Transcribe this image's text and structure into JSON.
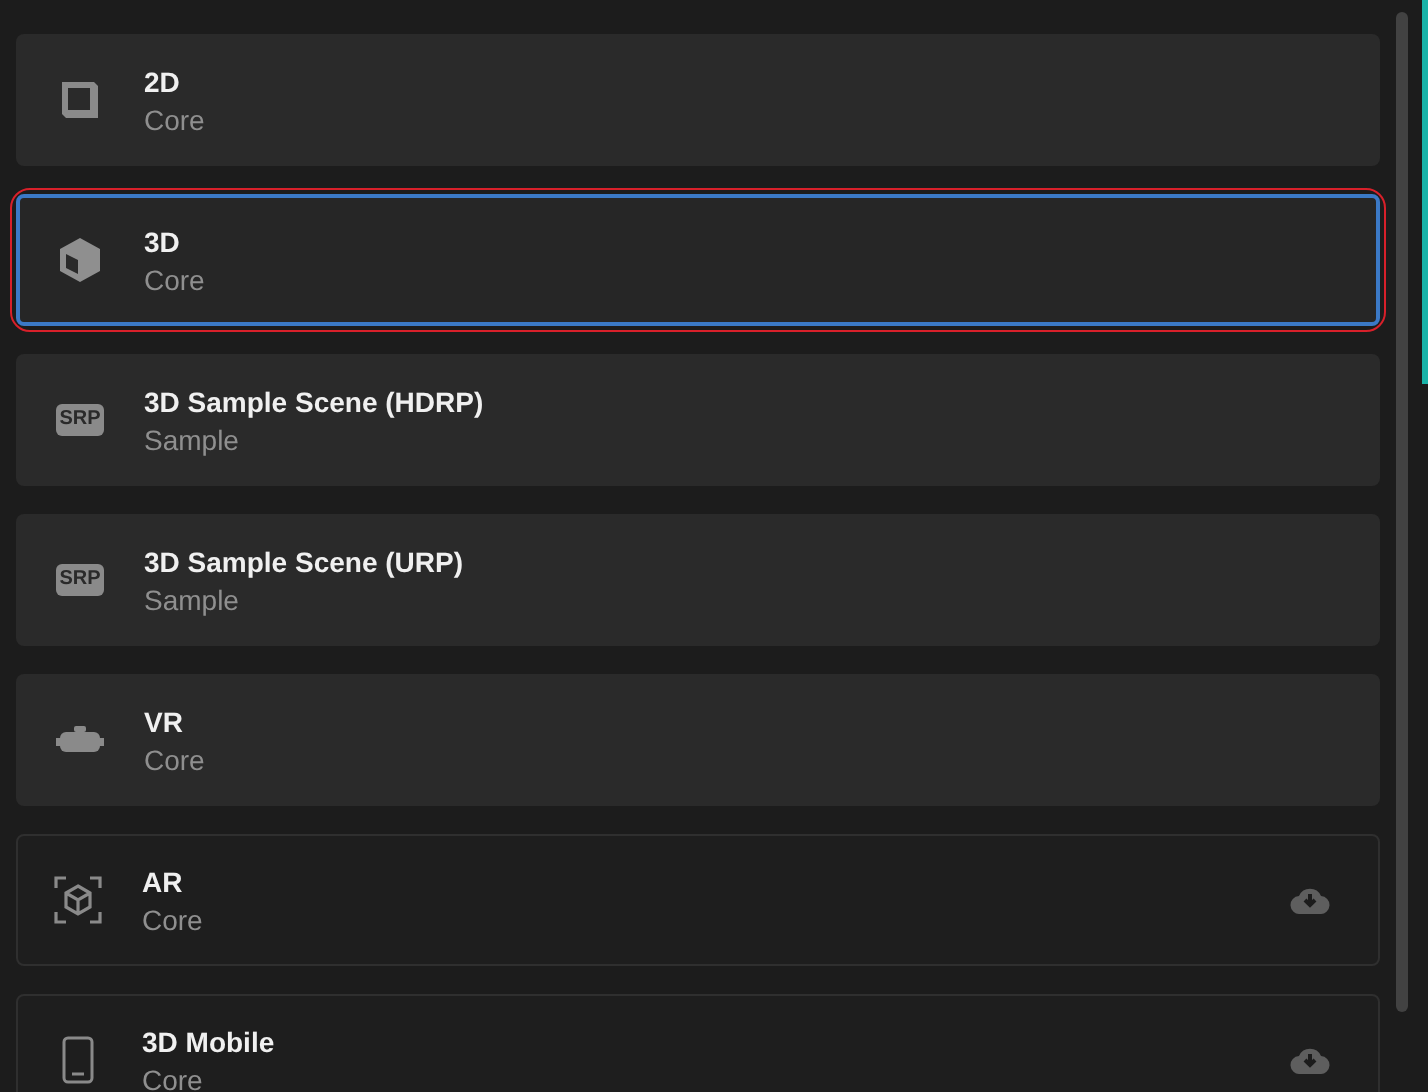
{
  "templates": [
    {
      "title": "2D",
      "subtitle": "Core",
      "kind": "square",
      "selected": false,
      "annotated": false,
      "downloaded": true
    },
    {
      "title": "3D",
      "subtitle": "Core",
      "kind": "cube",
      "selected": true,
      "annotated": true,
      "downloaded": true
    },
    {
      "title": "3D Sample Scene (HDRP)",
      "subtitle": "Sample",
      "kind": "srp",
      "badge": "SRP",
      "selected": false,
      "annotated": false,
      "downloaded": true
    },
    {
      "title": "3D Sample Scene (URP)",
      "subtitle": "Sample",
      "kind": "srp",
      "badge": "SRP",
      "selected": false,
      "annotated": false,
      "downloaded": true
    },
    {
      "title": "VR",
      "subtitle": "Core",
      "kind": "vr",
      "selected": false,
      "annotated": false,
      "downloaded": true
    },
    {
      "title": "AR",
      "subtitle": "Core",
      "kind": "ar",
      "selected": false,
      "annotated": false,
      "downloaded": false
    },
    {
      "title": "3D Mobile",
      "subtitle": "Core",
      "kind": "mobile",
      "selected": false,
      "annotated": false,
      "downloaded": false
    }
  ]
}
